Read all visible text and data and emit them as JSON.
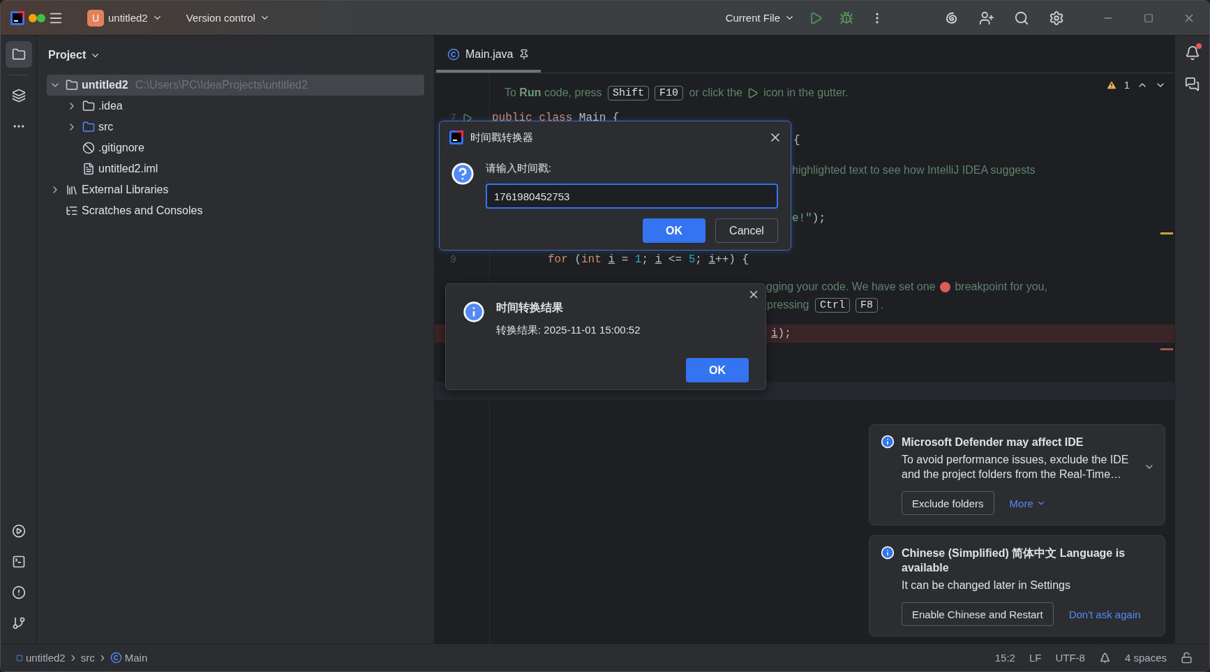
{
  "title_bar": {
    "project_badge": "U",
    "project": "untitled2",
    "vcs": "Version control",
    "run_config": "Current File"
  },
  "project_panel": {
    "title": "Project",
    "tree": [
      {
        "kind": "module",
        "name": "untitled2",
        "path": "C:\\Users\\PC\\IdeaProjects\\untitled2",
        "expanded": true,
        "selected": true,
        "children": [
          {
            "kind": "folder",
            "name": ".idea",
            "expanded": false,
            "selected": false
          },
          {
            "kind": "source_folder",
            "name": "src",
            "expanded": false,
            "selected": false
          },
          {
            "kind": "ignore_file",
            "name": ".gitignore",
            "selected": false
          },
          {
            "kind": "module_file",
            "name": "untitled2.iml",
            "selected": false
          }
        ]
      },
      {
        "kind": "library",
        "name": "External Libraries",
        "expanded": false,
        "selected": false
      },
      {
        "kind": "scratches",
        "name": "Scratches and Consoles",
        "selected": false
      }
    ]
  },
  "editor": {
    "tabs": [
      {
        "label": "Main.java",
        "selected": true,
        "pinned": true
      }
    ],
    "warnings": "1",
    "lines": [
      {
        "kind": "doc",
        "tokens": [
          {
            "kind": "doc",
            "text": "To "
          },
          {
            "kind": "doc_bold",
            "text": "Run"
          },
          {
            "kind": "doc",
            "text": " code, press "
          },
          {
            "kind": "key",
            "text": "Shift"
          },
          {
            "kind": "key",
            "text": "F10"
          },
          {
            "kind": "doc",
            "text": " or click the "
          },
          {
            "kind": "play"
          },
          {
            "kind": "doc",
            "text": " icon in the gutter."
          }
        ]
      },
      {
        "kind": "code",
        "number": "7",
        "run_marker": true,
        "tokens": [
          {
            "kind": "kw",
            "text": "public "
          },
          {
            "kind": "kw",
            "text": "class "
          },
          {
            "kind": "plain",
            "text": "Main {"
          }
        ]
      },
      {
        "kind": "code",
        "tokens": [
          {
            "kind": "plain",
            "text": "{"
          }
        ]
      },
      {
        "kind": "doc",
        "tokens": [
          {
            "kind": "doc",
            "text": "highlighted text to see how IntelliJ IDEA suggests"
          }
        ]
      },
      {
        "kind": "code",
        "tokens": [
          {
            "kind": "str",
            "text": "e!\""
          },
          {
            "kind": "plain",
            "text": ");"
          }
        ]
      },
      {
        "kind": "code",
        "number": "9",
        "tokens": [
          {
            "kind": "kw",
            "text": "for"
          },
          {
            "kind": "plain",
            "text": " ("
          },
          {
            "kind": "kw",
            "text": "int "
          },
          {
            "kind": "var",
            "text": "i"
          },
          {
            "kind": "plain",
            "text": " = "
          },
          {
            "kind": "num",
            "text": "1"
          },
          {
            "kind": "plain",
            "text": "; "
          },
          {
            "kind": "var",
            "text": "i"
          },
          {
            "kind": "plain",
            "text": " <= "
          },
          {
            "kind": "num",
            "text": "5"
          },
          {
            "kind": "plain",
            "text": "; "
          },
          {
            "kind": "var",
            "text": "i"
          },
          {
            "kind": "plain",
            "text": "++) {"
          }
        ]
      },
      {
        "kind": "doc",
        "tokens": [
          {
            "kind": "doc",
            "text": "gging your code. We have set one "
          },
          {
            "kind": "dot"
          },
          {
            "kind": "doc",
            "text": " breakpoint for you,"
          }
        ]
      },
      {
        "kind": "doc",
        "tokens": [
          {
            "kind": "doc",
            "text": "pressing "
          },
          {
            "kind": "key",
            "text": "Ctrl"
          },
          {
            "kind": "key",
            "text": "F8"
          },
          {
            "kind": "doc",
            "text": "."
          }
        ]
      },
      {
        "kind": "breakpoint",
        "tokens": [
          {
            "kind": "var",
            "text": "i"
          },
          {
            "kind": "plain",
            "text": ");"
          }
        ]
      },
      {
        "kind": "current"
      }
    ]
  },
  "input_dialog": {
    "title": "时间戳转换器",
    "prompt": "请输入时间戳:",
    "value": "1761980452753",
    "focused": true,
    "ok": "OK",
    "cancel": "Cancel"
  },
  "message_dialog": {
    "title": "时间转换结果",
    "message": "转换结果: 2025-11-01 15:00:52",
    "ok": "OK"
  },
  "notifications": [
    {
      "title": "Microsoft Defender may affect IDE",
      "body": "To avoid performance issues, exclude the IDE and the project folders from the Real-Time…",
      "expandable": true,
      "actions": [
        {
          "kind": "button",
          "label": "Exclude folders"
        },
        {
          "kind": "dropdown_link",
          "label": "More"
        }
      ]
    },
    {
      "title": "Chinese (Simplified) 简体中文 Language is available",
      "body": "It can be changed later in Settings",
      "expandable": false,
      "actions": [
        {
          "kind": "button",
          "label": "Enable Chinese and Restart"
        },
        {
          "kind": "link",
          "label": "Don't ask again"
        }
      ]
    }
  ],
  "status_bar": {
    "breadcrumbs": [
      {
        "kind": "module",
        "label": "untitled2"
      },
      {
        "kind": "folder",
        "label": "src"
      },
      {
        "kind": "class",
        "label": "Main"
      }
    ],
    "position": "15:2",
    "line_separator": "LF",
    "encoding": "UTF-8",
    "indent": "4 spaces"
  }
}
